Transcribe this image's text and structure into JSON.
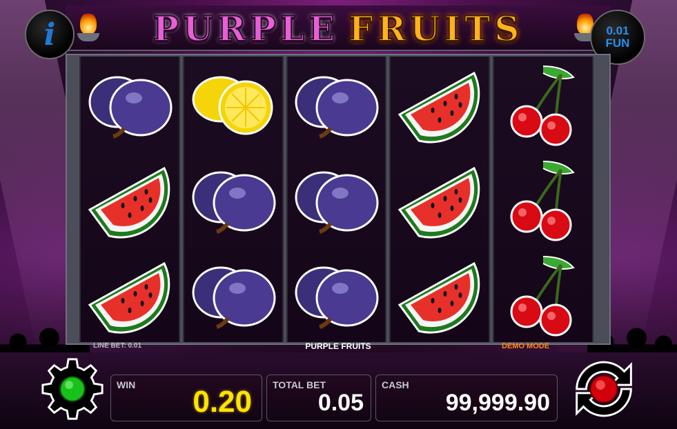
{
  "game": {
    "title_part1": "PURPLE",
    "title_part2": "FRUITS",
    "info_icon": "i",
    "coin_value": "0.01",
    "currency": "FUN"
  },
  "reels": [
    [
      "plum",
      "watermelon",
      "watermelon"
    ],
    [
      "lemon",
      "plum",
      "plum"
    ],
    [
      "plum",
      "plum",
      "plum"
    ],
    [
      "watermelon",
      "watermelon",
      "watermelon"
    ],
    [
      "cherries",
      "cherries",
      "cherries"
    ]
  ],
  "strip": {
    "line_bet": "LINE BET: 0.01",
    "game_name": "PURPLE FRUITS",
    "mode": "DEMO MODE"
  },
  "panel": {
    "win_label": "WIN",
    "win_value": "0.20",
    "total_bet_label": "TOTAL BET",
    "total_bet_value": "0.05",
    "cash_label": "CASH",
    "cash_value": "99,999.90"
  },
  "icons": {
    "settings": "gear-icon",
    "spin": "spin-icon",
    "info": "info-icon"
  },
  "colors": {
    "win_value": "#ffe400",
    "demo_mode": "#ff8a1a",
    "coin_text": "#2a8ef0"
  }
}
